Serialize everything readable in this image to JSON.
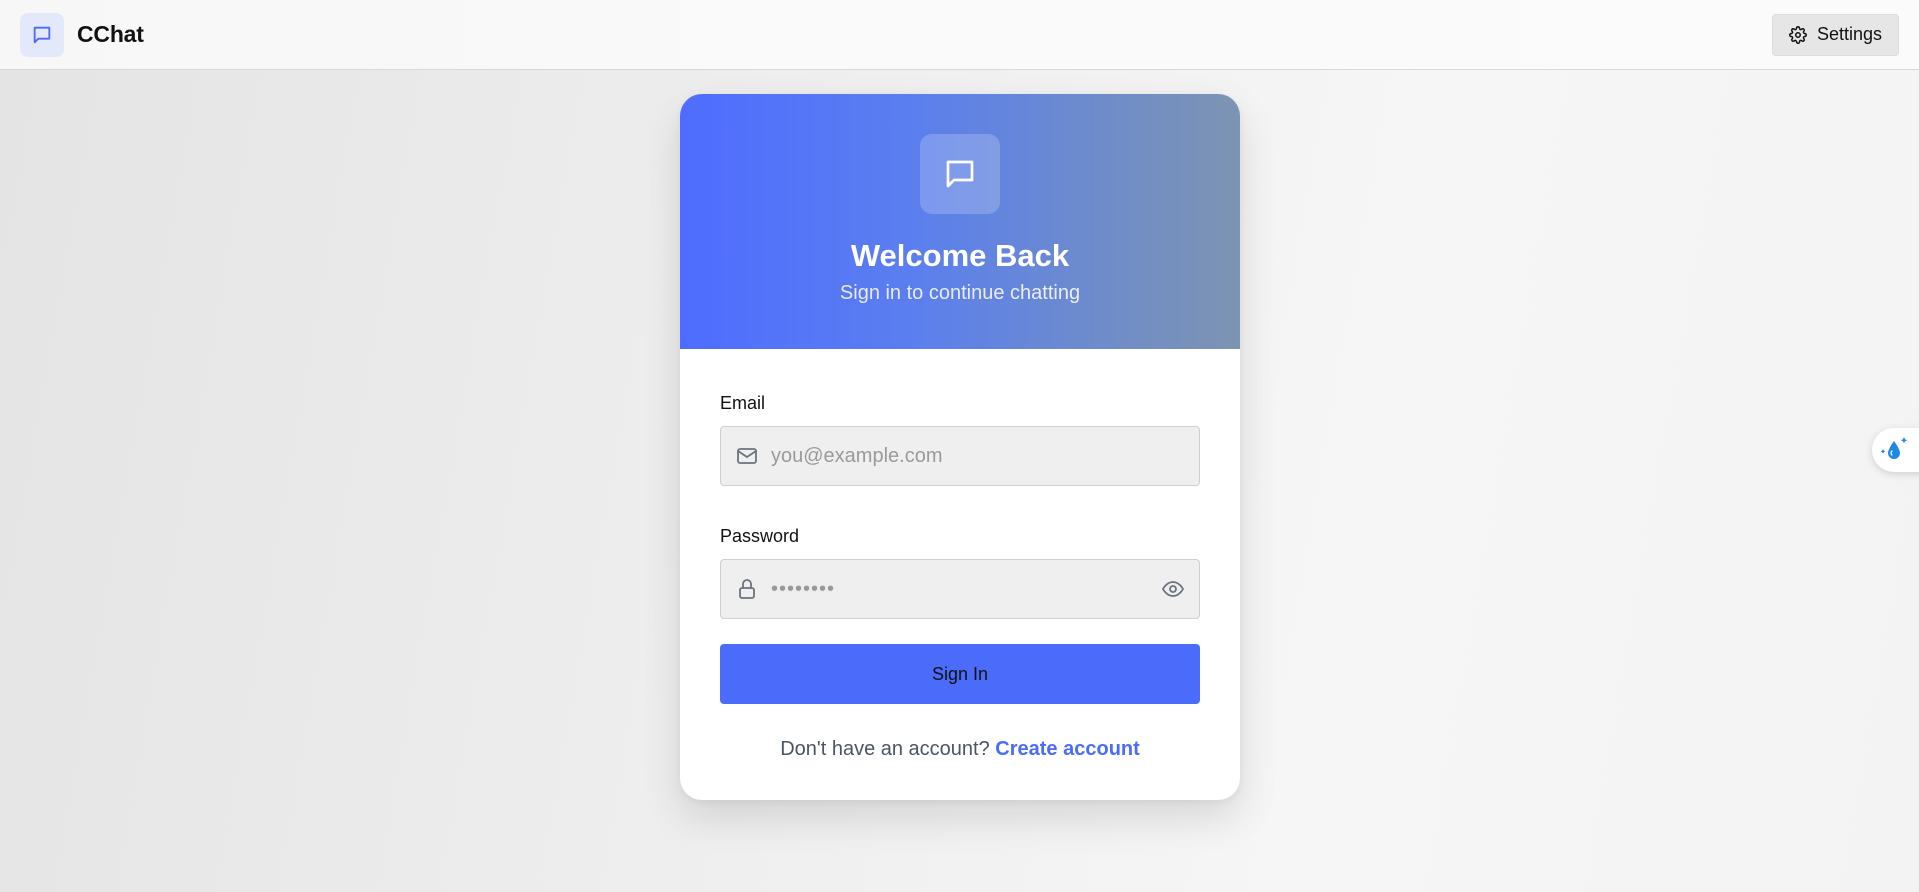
{
  "app": {
    "name": "CChat",
    "logo_icon": "chat-bubble-icon",
    "settings_label": "Settings",
    "settings_icon": "gear-icon"
  },
  "login": {
    "hero_icon": "chat-bubble-icon",
    "title": "Welcome Back",
    "subtitle": "Sign in to continue chatting",
    "email": {
      "label": "Email",
      "placeholder": "you@example.com",
      "value": "",
      "icon": "mail-icon"
    },
    "password": {
      "label": "Password",
      "placeholder": "••••••••",
      "value": "",
      "icon": "lock-icon",
      "toggle_icon": "eye-icon"
    },
    "submit_label": "Sign In",
    "footer_text": "Don't have an account?",
    "footer_link": "Create account"
  },
  "floating_widget": {
    "icon": "sparkle-drop-icon"
  },
  "colors": {
    "accent": "#4b6bfb",
    "hero_gradient_start": "#4f6cff",
    "hero_gradient_end": "#7d94b2",
    "brand_logo_bg": "#e3e8fb"
  }
}
